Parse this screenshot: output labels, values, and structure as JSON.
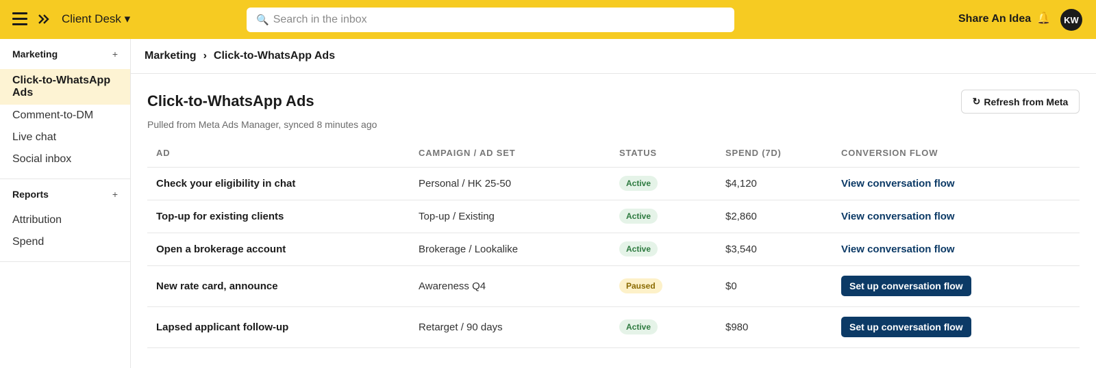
{
  "topbar": {
    "workspace": "Client Desk ▾",
    "search_placeholder": "Search in the inbox",
    "share_label": "Share An Idea",
    "avatar_initials": "KW",
    "bell_glyph": "🔔",
    "search_glyph": "🔍"
  },
  "sidebar": {
    "sections": [
      {
        "title": "Marketing",
        "plus": "+",
        "items": [
          {
            "label": "Click-to-WhatsApp Ads",
            "active": true
          },
          {
            "label": "Comment-to-DM"
          },
          {
            "label": "Live chat"
          },
          {
            "label": "Social inbox"
          }
        ]
      },
      {
        "title": "Reports",
        "plus": "+",
        "items": [
          {
            "label": "Attribution"
          },
          {
            "label": "Spend"
          }
        ]
      }
    ]
  },
  "breadcrumb": {
    "parent": "Marketing",
    "separator": "›",
    "current": "Click-to-WhatsApp Ads"
  },
  "page": {
    "title": "Click-to-WhatsApp Ads",
    "subtitle": "Pulled from Meta Ads Manager, synced 8 minutes ago",
    "refresh_glyph": "↻",
    "refresh_label": "Refresh from Meta"
  },
  "table": {
    "columns": [
      "AD",
      "CAMPAIGN / AD SET",
      "STATUS",
      "SPEND (7D)",
      "CONVERSION FLOW"
    ],
    "rows": [
      {
        "ad": "Check your eligibility in chat",
        "campaign": "Personal / HK 25-50",
        "status": "Active",
        "spend": "$4,120",
        "flow": "View conversation flow"
      },
      {
        "ad": "Top-up for existing clients",
        "campaign": "Top-up / Existing",
        "status": "Active",
        "spend": "$2,860",
        "flow": "View conversation flow"
      },
      {
        "ad": "Open a brokerage account",
        "campaign": "Brokerage / Lookalike",
        "status": "Active",
        "spend": "$3,540",
        "flow": "View conversation flow"
      },
      {
        "ad": "New rate card, announce",
        "campaign": "Awareness Q4",
        "status": "Paused",
        "spend": "$0",
        "flow": "Set up conversation flow"
      },
      {
        "ad": "Lapsed applicant follow-up",
        "campaign": "Retarget / 90 days",
        "status": "Active",
        "spend": "$980",
        "flow": "Set up conversation flow"
      }
    ]
  },
  "colors": {
    "brand_yellow": "#f6cb22",
    "navy": "#0c3a66",
    "active_green": "#2d7a3f",
    "paused_amber": "#8a6a00"
  }
}
